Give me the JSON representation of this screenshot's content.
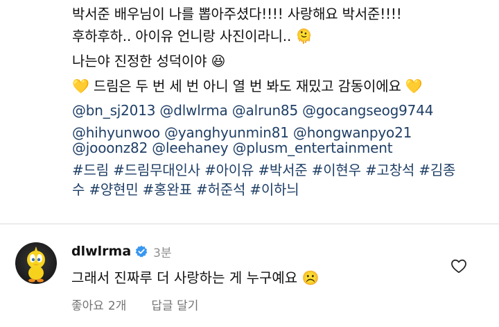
{
  "caption": {
    "line1": "박서준 배우님이 나를 뽑아주셨다!!!! 사랑해요 박서준!!!!",
    "line2_text": "후하후하.. 아이유 언니랑 사진이라니..",
    "line2_emoji": "🫠",
    "line3_text": "나는야 진정한 성덕이야",
    "line3_emoji": "😆",
    "line4_heart_left": "💛",
    "line4_text": "드림은 두 번 세 번 아니 열 번 봐도 재밌고 감동이에요",
    "line4_heart_right": "💛",
    "mentions_line1": "@bn_sj2013 @dlwlrma @alrun85 @gocangseog9744",
    "mentions_line2": "@hihyunwoo @yanghyunmin81 @hongwanpyo21",
    "mentions_line3": "@jooonz82 @leehaney @plusm_entertainment",
    "hashtags_line1": "#드림 #드림무대인사 #아이유 #박서준 #이현우 #고창석 #김종",
    "hashtags_line2": "수 #양현민 #홍완표 #허준석 #이하늬"
  },
  "comment": {
    "username": "dlwlrma",
    "time": "3분",
    "text": "그래서 진짜루 더 사랑하는 게 누구예요",
    "emoji": "☹️",
    "like_label": "좋아요",
    "like_count": "2개",
    "reply_label": "답글 달기"
  },
  "colors": {
    "link": "#1f3f66",
    "meta": "#8e8e8e",
    "verified": "#3897f0"
  },
  "icons": {
    "verified": "verified-badge-icon",
    "like": "heart-outline-icon",
    "avatar": "tweety-avatar"
  }
}
